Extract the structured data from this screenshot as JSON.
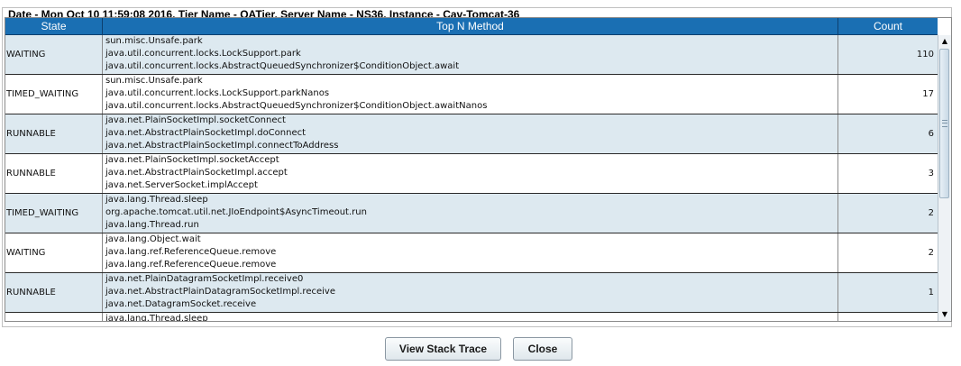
{
  "panel": {
    "title": "Date - Mon Oct 10 11:59:08 2016, Tier Name - QATier, Server Name - NS36, Instance - Cav-Tomcat-36"
  },
  "table": {
    "columns": [
      "State",
      "Top N Method",
      "Count"
    ],
    "rows": [
      {
        "state": "WAITING",
        "methods": [
          "sun.misc.Unsafe.park",
          "java.util.concurrent.locks.LockSupport.park",
          "java.util.concurrent.locks.AbstractQueuedSynchronizer$ConditionObject.await"
        ],
        "count": "110"
      },
      {
        "state": "TIMED_WAITING",
        "methods": [
          "sun.misc.Unsafe.park",
          "java.util.concurrent.locks.LockSupport.parkNanos",
          "java.util.concurrent.locks.AbstractQueuedSynchronizer$ConditionObject.awaitNanos"
        ],
        "count": "17"
      },
      {
        "state": "RUNNABLE",
        "methods": [
          "java.net.PlainSocketImpl.socketConnect",
          "java.net.AbstractPlainSocketImpl.doConnect",
          "java.net.AbstractPlainSocketImpl.connectToAddress"
        ],
        "count": "6"
      },
      {
        "state": "RUNNABLE",
        "methods": [
          "java.net.PlainSocketImpl.socketAccept",
          "java.net.AbstractPlainSocketImpl.accept",
          "java.net.ServerSocket.implAccept"
        ],
        "count": "3"
      },
      {
        "state": "TIMED_WAITING",
        "methods": [
          "java.lang.Thread.sleep",
          "org.apache.tomcat.util.net.JIoEndpoint$AsyncTimeout.run",
          "java.lang.Thread.run"
        ],
        "count": "2"
      },
      {
        "state": "WAITING",
        "methods": [
          "java.lang.Object.wait",
          "java.lang.ref.ReferenceQueue.remove",
          "java.lang.ref.ReferenceQueue.remove"
        ],
        "count": "2"
      },
      {
        "state": "RUNNABLE",
        "methods": [
          "java.net.PlainDatagramSocketImpl.receive0",
          "java.net.AbstractPlainDatagramSocketImpl.receive",
          "java.net.DatagramSocket.receive"
        ],
        "count": "1"
      },
      {
        "state": "",
        "methods": [
          "java.lang.Thread.sleep",
          "",
          ""
        ],
        "count": ""
      }
    ]
  },
  "scrollbar": {
    "up_icon": "arrow-up-icon",
    "down_icon": "arrow-down-icon",
    "up_glyph": "▲",
    "down_glyph": "▼"
  },
  "buttons": {
    "view_stack_trace": "View Stack Trace",
    "close": "Close"
  },
  "colors": {
    "header_bg": "#1a6fb3",
    "row_alt_bg": "#dde9f0"
  }
}
